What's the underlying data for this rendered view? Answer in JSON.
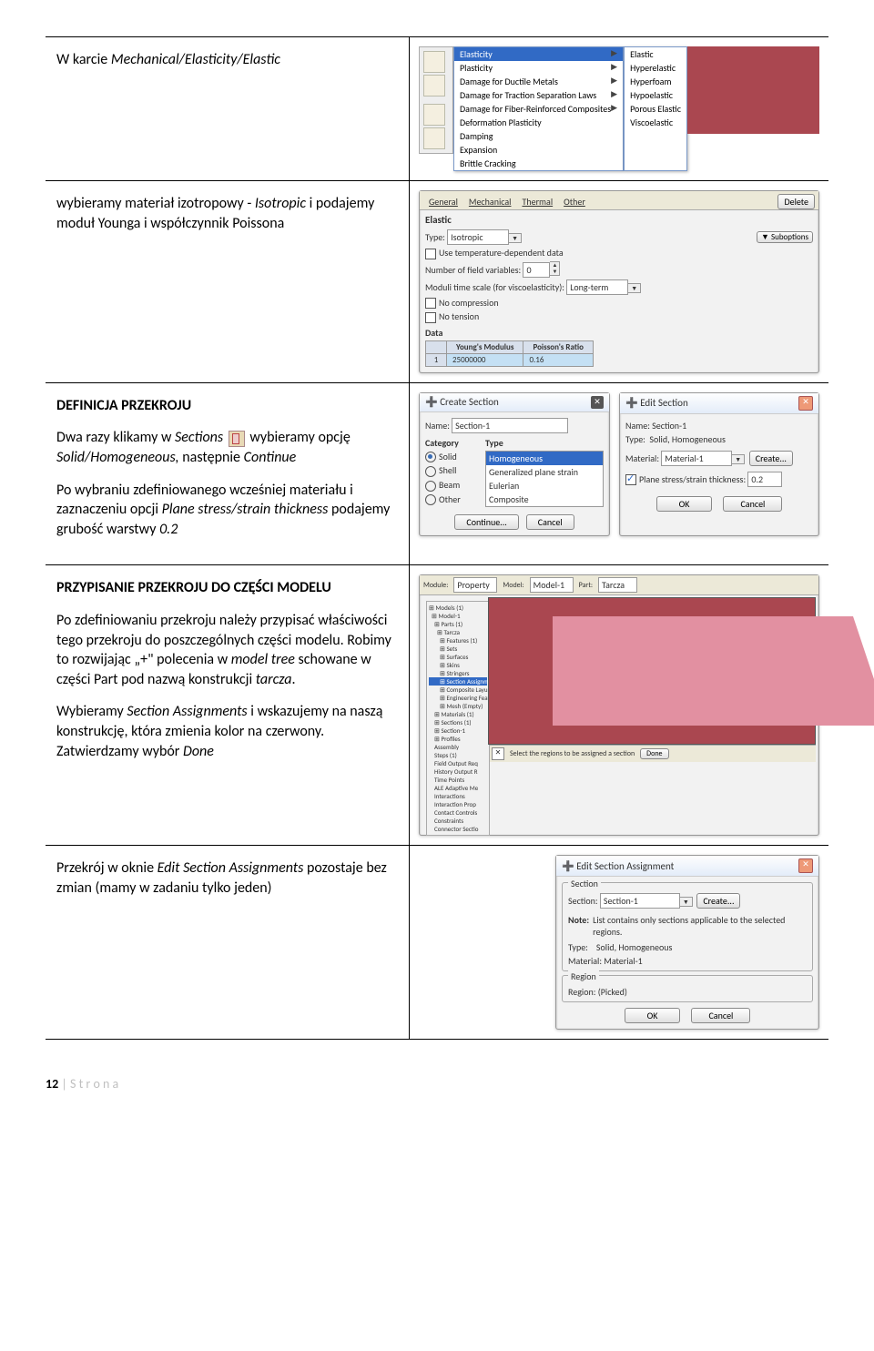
{
  "row1": {
    "text": "W karcie",
    "pathitalic": "Mechanical/Elasticity/Elastic",
    "menu": {
      "items": [
        "Elasticity",
        "Plasticity",
        "Damage for Ductile Metals",
        "Damage for Traction Separation Laws",
        "Damage for Fiber-Reinforced Composites",
        "Deformation Plasticity",
        "Damping",
        "Expansion",
        "Brittle Cracking"
      ],
      "sel": "Elasticity",
      "sub": [
        "Elastic",
        "Hyperelastic",
        "Hyperfoam",
        "Hypoelastic",
        "Porous Elastic",
        "Viscoelastic"
      ]
    }
  },
  "row2": {
    "p1a": "wybieramy materiał izotropowy - ",
    "p1b": "Isotropic",
    "p1c": " i podajemy moduł Younga i współczynnik Poissona",
    "dlg": {
      "tabs": [
        "General",
        "Mechanical",
        "Thermal",
        "Other"
      ],
      "del": "Delete",
      "section": "Elastic",
      "type_l": "Type:",
      "type_v": "Isotropic",
      "sub": "Suboptions",
      "opt1": "Use temperature-dependent data",
      "opt2_l": "Number of field variables:",
      "opt2_v": "0",
      "opt3_l": "Moduli time scale (for viscoelasticity):",
      "opt3_v": "Long-term",
      "opt4": "No compression",
      "opt5": "No tension",
      "data": "Data",
      "h1": "Young's Modulus",
      "h2": "Poisson's Ratio",
      "v1": "25000000",
      "v2": "0.16"
    }
  },
  "row3": {
    "h1": "DEFINICJA PRZEKROJU",
    "p1a": "Dwa razy klikamy w ",
    "p1ai": "Sections",
    "p1b": " wybieramy opcję ",
    "p1bi": "Solid/Homogeneous,",
    "p1c": " następnie ",
    "p1ci": "Continue",
    "p2a": "Po wybraniu zdefiniowanego wcześniej materiału i zaznaczeniu opcji ",
    "p2i": "Plane stress/strain thickness",
    "p2b": " podajemy grubość warstwy ",
    "p2bi": "0.2",
    "cs": {
      "title": "Create Section",
      "name_l": "Name:",
      "name_v": "Section-1",
      "cat": "Category",
      "type": "Type",
      "cats": [
        "Solid",
        "Shell",
        "Beam",
        "Other"
      ],
      "types": [
        "Homogeneous",
        "Generalized plane strain",
        "Eulerian",
        "Composite"
      ],
      "types_sel": "Homogeneous",
      "cont": "Continue...",
      "cancel": "Cancel"
    },
    "es": {
      "title": "Edit Section",
      "x": "✕",
      "name_l": "Name:",
      "name_v": "Section-1",
      "type_l": "Type:",
      "type_v": "Solid, Homogeneous",
      "mat_l": "Material:",
      "mat_v": "Material-1",
      "create": "Create...",
      "pss_l": "Plane stress/strain thickness:",
      "pss_v": "0.2",
      "ok": "OK",
      "cancel": "Cancel"
    }
  },
  "row4": {
    "h1": "PRZYPISANIE PRZEKROJU DO CZĘŚCI MODELU",
    "p1": "Po zdefiniowaniu przekroju należy przypisać właściwości tego przekroju  do poszczególnych części modelu. Robimy to rozwijając „+\" polecenia w ",
    "p1i": "model tree",
    "p1b": " schowane w części Part pod nazwą konstrukcji ",
    "p1bi": "tarcza",
    "p1c": ".",
    "p2a": "Wybieramy ",
    "p2i": "Section Assignments",
    "p2b": " i wskazujemy na naszą konstrukcję, która zmienia kolor na czerwony. Zatwierdzamy wybór ",
    "p2bi": "Done",
    "prompt": "Select the regions to be assigned a section",
    "done": "Done",
    "tree": [
      "Models (1)",
      "Model-1",
      "Parts (1)",
      "Tarcza",
      "Features (1)",
      "Sets",
      "Surfaces",
      "Skins",
      "Stringers",
      "Section Assignm",
      "Composite Layup",
      "Engineering Feat",
      "Mesh (Empty)",
      "Materials (1)",
      "Sections (1)",
      "Section-1",
      "Profiles",
      "Assembly",
      "Steps (1)",
      "Field Output Req",
      "History Output R",
      "Time Points",
      "ALE Adaptive Me",
      "Interactions",
      "Interaction Prop",
      "Contact Controls",
      "Constraints",
      "Connector Sectio"
    ],
    "ctx": {
      "mod": "Module:",
      "modv": "Property",
      "mdl": "Model:",
      "mdlv": "Model-1",
      "prt": "Part:",
      "prtv": "Tarcza"
    }
  },
  "row5": {
    "p1a": "Przekrój w oknie ",
    "p1i": "Edit Section Assignments",
    "p1b": " pozostaje bez zmian (mamy w zadaniu tylko jeden)",
    "dlg": {
      "title": "Edit Section Assignment",
      "x": "✕",
      "sec": "Section",
      "sec_l": "Section:",
      "sec_v": "Section-1",
      "create": "Create...",
      "note_l": "Note:",
      "note_v": "List contains only sections applicable to the selected regions.",
      "type_l": "Type:",
      "type_v": "Solid, Homogeneous",
      "mat_l": "Material:",
      "mat_v": "Material-1",
      "reg": "Region",
      "reg_l": "Region:",
      "reg_v": "(Picked)",
      "ok": "OK",
      "cancel": "Cancel"
    }
  },
  "footer": {
    "n": "12",
    "bar": " | ",
    "s": "S t r o n a"
  }
}
